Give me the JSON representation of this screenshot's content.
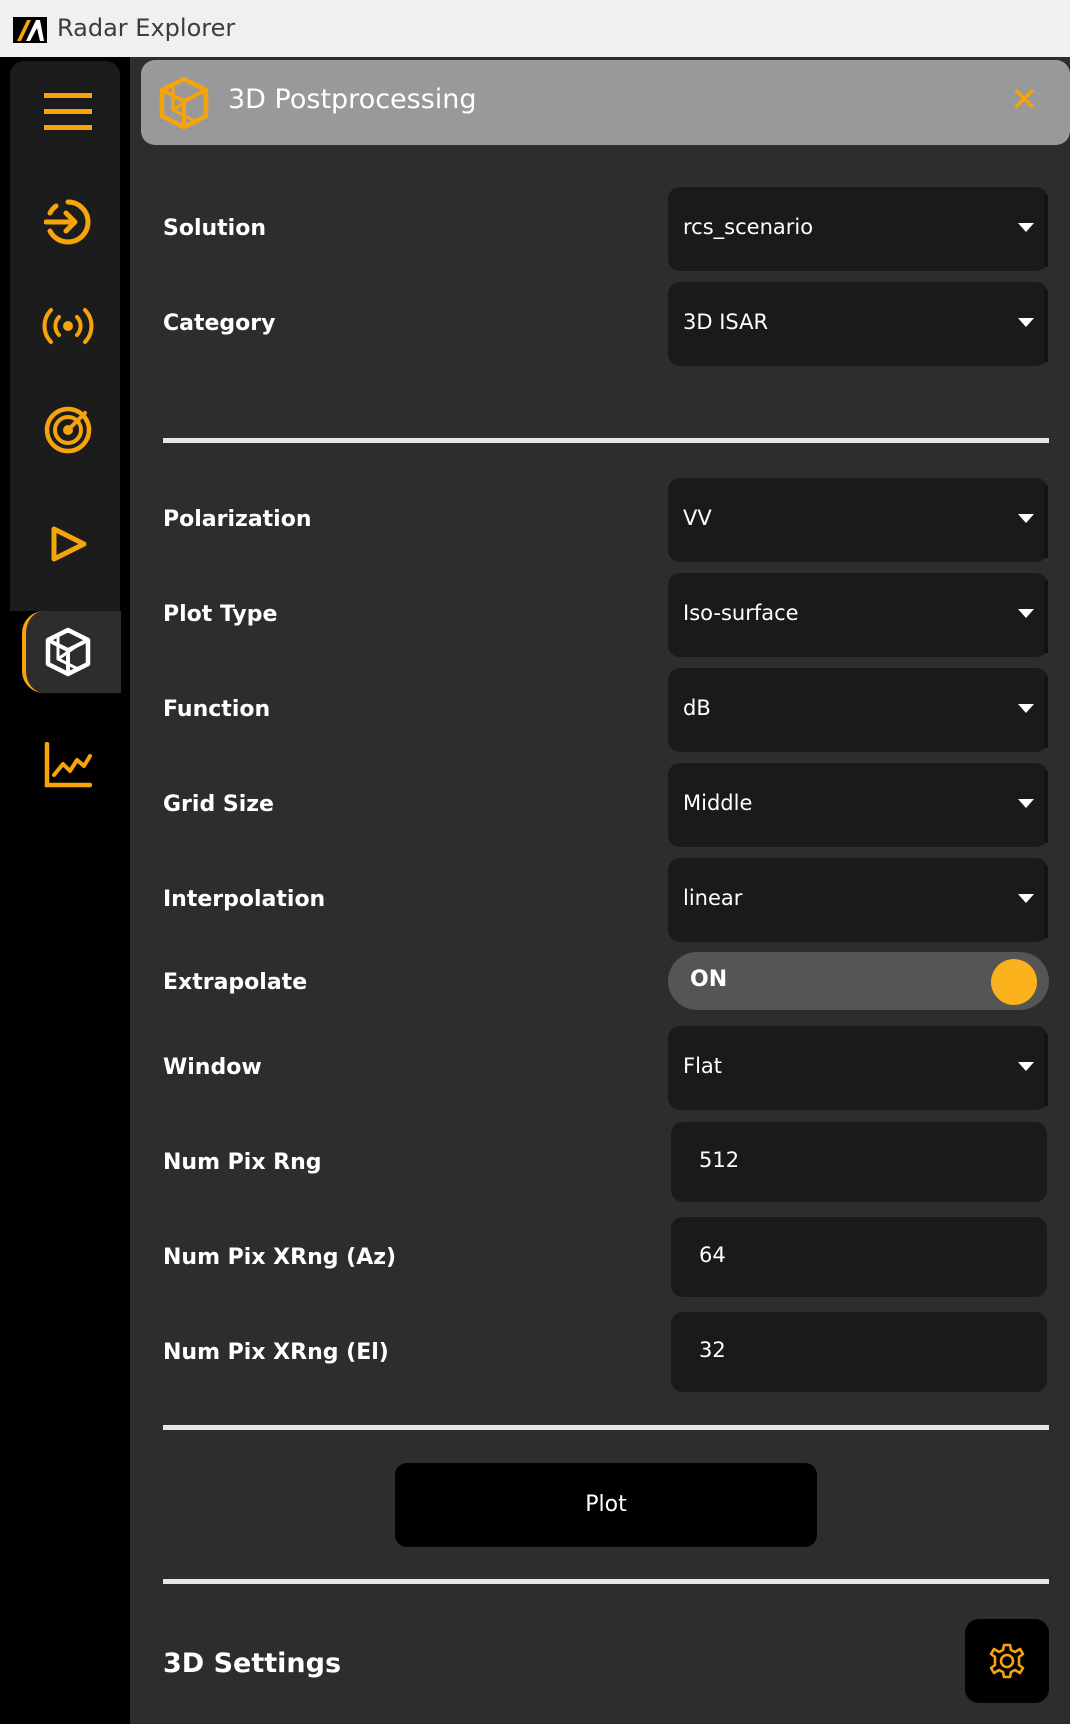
{
  "window": {
    "title": "Radar Explorer"
  },
  "sidebar": {
    "items": [
      {
        "icon": "menu-icon"
      },
      {
        "icon": "import-icon"
      },
      {
        "icon": "antenna-icon"
      },
      {
        "icon": "radar-icon"
      },
      {
        "icon": "play-icon"
      },
      {
        "icon": "cube-icon",
        "active": true
      },
      {
        "icon": "chart-icon"
      }
    ],
    "accent": "#f5a40c"
  },
  "header": {
    "title": "3D Postprocessing",
    "close_icon": "close-icon"
  },
  "form": {
    "solution": {
      "label": "Solution",
      "value": "rcs_scenario"
    },
    "category": {
      "label": "Category",
      "value": "3D ISAR"
    },
    "polarization": {
      "label": "Polarization",
      "value": "VV"
    },
    "plot_type": {
      "label": "Plot Type",
      "value": "Iso-surface"
    },
    "function": {
      "label": "Function",
      "value": "dB"
    },
    "grid_size": {
      "label": "Grid Size",
      "value": "Middle"
    },
    "interpolation": {
      "label": "Interpolation",
      "value": "linear"
    },
    "extrapolate": {
      "label": "Extrapolate",
      "value": "ON"
    },
    "window": {
      "label": "Window",
      "value": "Flat"
    },
    "num_pix_rng": {
      "label": "Num Pix Rng",
      "value": "512"
    },
    "num_pix_xrng_az": {
      "label": "Num Pix XRng (Az)",
      "value": "64"
    },
    "num_pix_xrng_el": {
      "label": "Num Pix XRng (El)",
      "value": "32"
    }
  },
  "actions": {
    "plot_label": "Plot"
  },
  "settings": {
    "title": "3D Settings",
    "icon": "gear-icon"
  }
}
